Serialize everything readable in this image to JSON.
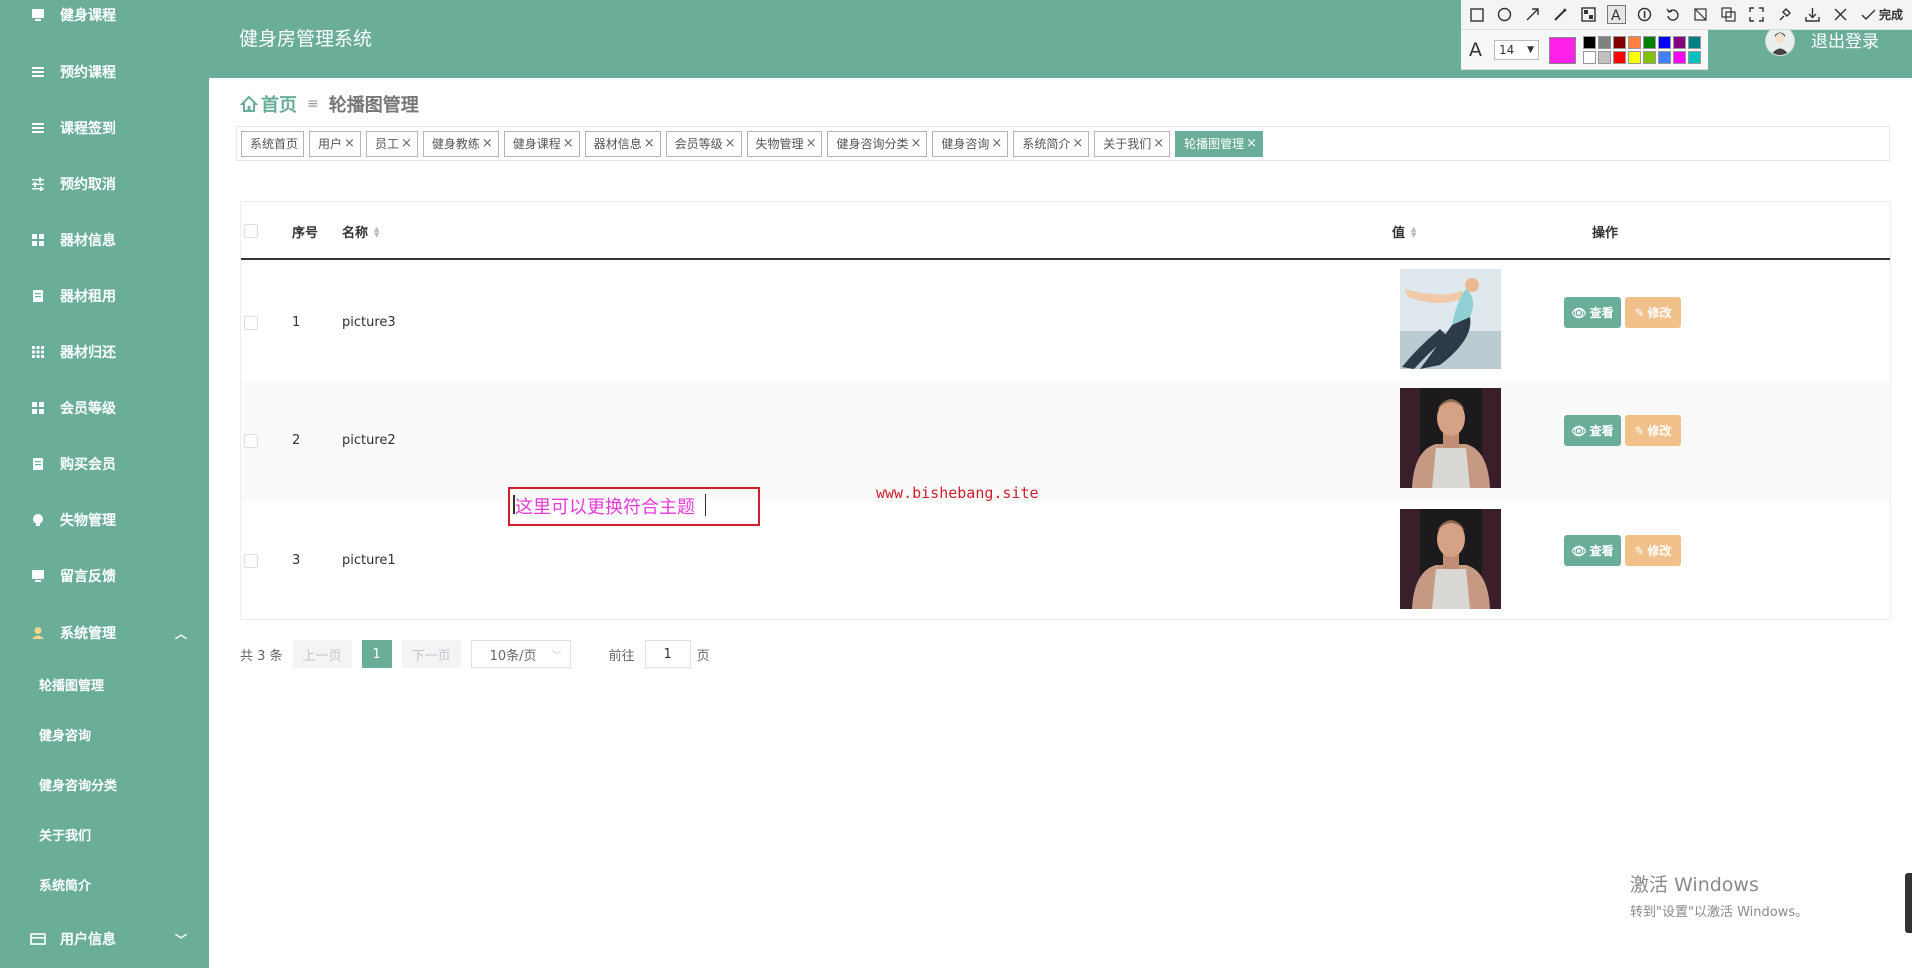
{
  "header": {
    "title": "健身房管理系统",
    "logout": "退出登录"
  },
  "sidebar": {
    "items": [
      {
        "label": "健身课程",
        "icon": "monitor-icon"
      },
      {
        "label": "预约课程",
        "icon": "list-icon"
      },
      {
        "label": "课程签到",
        "icon": "list-icon"
      },
      {
        "label": "预约取消",
        "icon": "sliders-icon"
      },
      {
        "label": "器材信息",
        "icon": "grid-icon"
      },
      {
        "label": "器材租用",
        "icon": "document-icon"
      },
      {
        "label": "器材归还",
        "icon": "apps-icon"
      },
      {
        "label": "会员等级",
        "icon": "grid-icon"
      },
      {
        "label": "购买会员",
        "icon": "document-icon"
      },
      {
        "label": "失物管理",
        "icon": "bulb-icon"
      },
      {
        "label": "留言反馈",
        "icon": "monitor-icon"
      },
      {
        "label": "系统管理",
        "icon": "user-icon",
        "expanded": true
      },
      {
        "label": "用户信息",
        "icon": "card-icon",
        "expanded": false
      }
    ],
    "system_sub": [
      "轮播图管理",
      "健身咨询",
      "健身咨询分类",
      "关于我们",
      "系统简介"
    ]
  },
  "breadcrumb": {
    "home": "首页",
    "current": "轮播图管理"
  },
  "tags": [
    {
      "label": "系统首页",
      "closable": false
    },
    {
      "label": "用户",
      "closable": true
    },
    {
      "label": "员工",
      "closable": true
    },
    {
      "label": "健身教练",
      "closable": true
    },
    {
      "label": "健身课程",
      "closable": true
    },
    {
      "label": "器材信息",
      "closable": true
    },
    {
      "label": "会员等级",
      "closable": true
    },
    {
      "label": "失物管理",
      "closable": true
    },
    {
      "label": "健身咨询分类",
      "closable": true
    },
    {
      "label": "健身咨询",
      "closable": true
    },
    {
      "label": "系统简介",
      "closable": true
    },
    {
      "label": "关于我们",
      "closable": true
    },
    {
      "label": "轮播图管理",
      "closable": true,
      "active": true
    }
  ],
  "table": {
    "headers": {
      "index": "序号",
      "name": "名称",
      "value": "值",
      "actions": "操作"
    },
    "rows": [
      {
        "index": "1",
        "name": "picture3",
        "image": "yoga-woman"
      },
      {
        "index": "2",
        "name": "picture2",
        "image": "man-portrait"
      },
      {
        "index": "3",
        "name": "picture1",
        "image": "man-portrait"
      }
    ],
    "view_label": "查看",
    "edit_label": "修改"
  },
  "pager": {
    "total": "共 3 条",
    "prev": "上一页",
    "current": "1",
    "next": "下一页",
    "page_size": "10条/页",
    "goto_label": "前往",
    "goto_value": "1",
    "page_suffix": "页"
  },
  "annotation": {
    "text": "这里可以更换符合主题",
    "watermark": "www.bishebang.site"
  },
  "tool": {
    "font_size": "14",
    "done": "完成",
    "current_color": "#ff21e7",
    "palette": [
      "#000000",
      "#808080",
      "#800000",
      "#ff8040",
      "#008000",
      "#0000ff",
      "#800080",
      "#008080",
      "#ffffff",
      "#c0c0c0",
      "#ff0000",
      "#ffff00",
      "#80c000",
      "#4080ff",
      "#ff00ff",
      "#00c0c0"
    ]
  },
  "windows": {
    "line1": "激活 Windows",
    "line2": "转到\"设置\"以激活 Windows。"
  },
  "colors": {
    "primary": "#6aae9a",
    "edit": "#f2c08a"
  }
}
